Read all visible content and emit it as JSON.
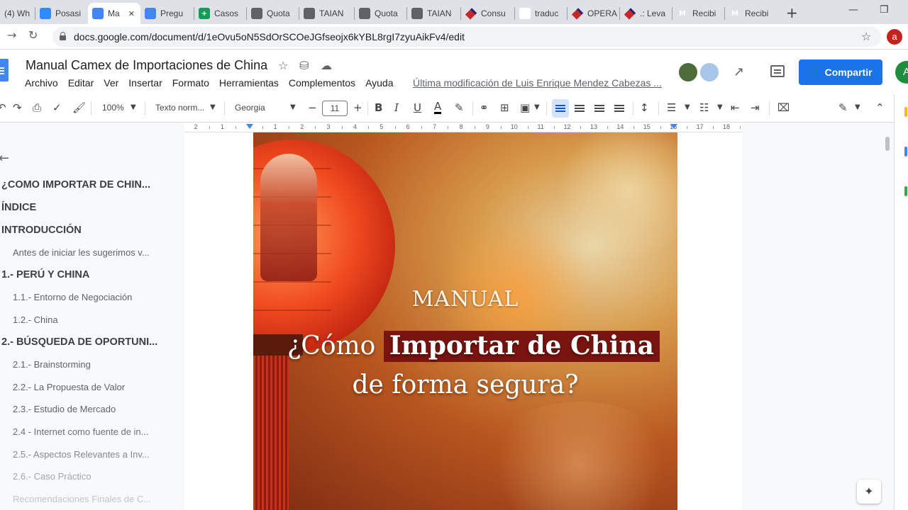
{
  "browser": {
    "tabs": [
      {
        "label": "(4) Wh",
        "icon": "whatsapp-icon"
      },
      {
        "label": "Posasi",
        "icon": "zoom-icon"
      },
      {
        "label": "Ma",
        "icon": "docs-icon",
        "active": true
      },
      {
        "label": "Pregu",
        "icon": "docs-icon"
      },
      {
        "label": "Casos",
        "icon": "sheets-icon"
      },
      {
        "label": "Quota",
        "icon": "globe-icon"
      },
      {
        "label": "TAIAN",
        "icon": "globe-icon"
      },
      {
        "label": "Quota",
        "icon": "globe-icon"
      },
      {
        "label": "TAIAN",
        "icon": "globe-icon"
      },
      {
        "label": "Consu",
        "icon": "diamond-icon"
      },
      {
        "label": "traduc",
        "icon": "google-icon"
      },
      {
        "label": "OPERA",
        "icon": "diamond-icon"
      },
      {
        "label": ".: Leva",
        "icon": "diamond-icon"
      },
      {
        "label": "Recibi",
        "icon": "gmail-icon"
      },
      {
        "label": "Recibi",
        "icon": "gmail-icon"
      }
    ],
    "url": "docs.google.com/document/d/1eOvu5oN5SdOrSCOeJGfseojx6kYBL8rgI7zyuAikFv4/edit",
    "profile_initial": "a"
  },
  "docs": {
    "title": "Manual Camex de Importaciones de China",
    "menu": [
      "Archivo",
      "Editar",
      "Ver",
      "Insertar",
      "Formato",
      "Herramientas",
      "Complementos",
      "Ayuda"
    ],
    "last_edit": "Última modificación de Luis Enrique Mendez Cabezas ...",
    "share_label": "Compartir",
    "user_initial": "A"
  },
  "toolbar": {
    "zoom": "100%",
    "style": "Texto norm...",
    "font": "Georgia",
    "font_size": "11"
  },
  "ruler": {
    "labels": [
      "2",
      "1",
      "",
      "1",
      "2",
      "3",
      "4",
      "5",
      "6",
      "7",
      "8",
      "9",
      "10",
      "11",
      "12",
      "13",
      "14",
      "15",
      "16",
      "17",
      "18"
    ]
  },
  "outline": {
    "items": [
      {
        "text": "¿COMO IMPORTAR DE CHIN...",
        "level": 1
      },
      {
        "text": "ÍNDICE",
        "level": 1
      },
      {
        "text": "INTRODUCCIÓN",
        "level": 1
      },
      {
        "text": "Antes de iniciar les sugerimos v...",
        "level": 2
      },
      {
        "text": "1.- PERÚ Y CHINA",
        "level": 1
      },
      {
        "text": "1.1.- Entorno de Negociación",
        "level": 2
      },
      {
        "text": "1.2.- China",
        "level": 2
      },
      {
        "text": "2.- BÚSQUEDA DE OPORTUNI...",
        "level": 1
      },
      {
        "text": "2.1.- Brainstorming",
        "level": 2
      },
      {
        "text": "2.2.- La Propuesta de Valor",
        "level": 2
      },
      {
        "text": "2.3.- Estudio de Mercado",
        "level": 2
      },
      {
        "text": "2.4 - Internet como fuente de in...",
        "level": 2
      },
      {
        "text": "2.5.- Aspectos Relevantes a Inv...",
        "level": 2
      },
      {
        "text": "2.6.- Caso Práctico",
        "level": 2
      },
      {
        "text": "Recomendaciones Finales de C...",
        "level": 2
      }
    ]
  },
  "cover": {
    "kicker": "MANUAL",
    "line1_pre": "¿Cómo",
    "line1_highlight": "Importar de China",
    "line2": "de forma segura?"
  }
}
